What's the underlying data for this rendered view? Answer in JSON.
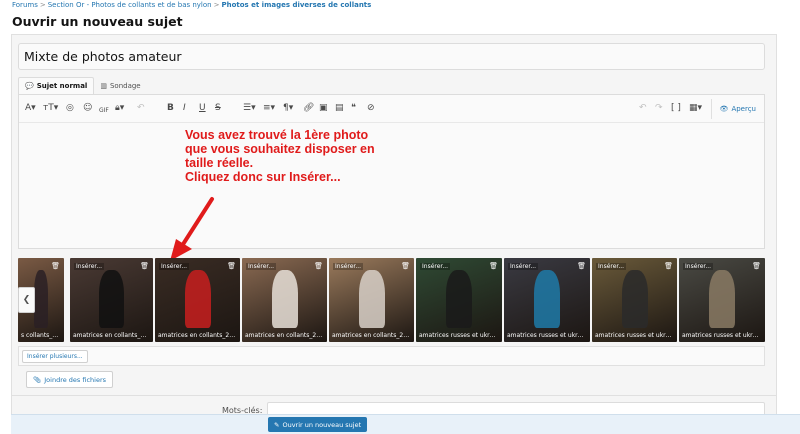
{
  "breadcrumb": {
    "items": [
      "Forums",
      "Section Or - Photos de collants et de bas nylon",
      "Photos et images diverses de collants"
    ],
    "separator": ">"
  },
  "page": {
    "title": "Ouvrir un nouveau sujet"
  },
  "form": {
    "title_value": "Mixte de photos amateur",
    "tabs": [
      {
        "label": "Sujet normal",
        "icon": "comments-icon",
        "active": true
      },
      {
        "label": "Sondage",
        "icon": "bar-chart-icon",
        "active": false
      }
    ],
    "preview_label": "Aperçu",
    "annotation_lines": [
      "Vous avez trouvé la 1ère photo",
      "que vous souhaitez disposer en",
      "taille réelle.",
      "Cliquez donc sur Insérer..."
    ],
    "annotation_color": "#e01b1b",
    "attachments": [
      {
        "insert_label": "",
        "caption": "s collants_204...",
        "bg": "#7a5a44",
        "accent": "#2a2024"
      },
      {
        "insert_label": "Insérer...",
        "caption": "amatrices en collants_205...",
        "bg": "#4a3a34",
        "accent": "#111111"
      },
      {
        "insert_label": "Insérer...",
        "caption": "amatrices en collants_206...",
        "bg": "#3a2c24",
        "accent": "#c81e1e"
      },
      {
        "insert_label": "Insérer...",
        "caption": "amatrices en collants_207...",
        "bg": "#8a6a52",
        "accent": "#e8e0d8"
      },
      {
        "insert_label": "Insérer...",
        "caption": "amatrices en collants_208...",
        "bg": "#9a7a5c",
        "accent": "#d8d0c8"
      },
      {
        "insert_label": "Insérer...",
        "caption": "amatrices russes et ukrain...",
        "bg": "#2f4a34",
        "accent": "#1a1a1a"
      },
      {
        "insert_label": "Insérer...",
        "caption": "amatrices russes et ukrain...",
        "bg": "#3a3a42",
        "accent": "#1e7aa8"
      },
      {
        "insert_label": "Insérer...",
        "caption": "amatrices russes et ukrain...",
        "bg": "#6a5a3a",
        "accent": "#2a2a2a"
      },
      {
        "insert_label": "Insérer...",
        "caption": "amatrices russes et ukrain...",
        "bg": "#4a4a44",
        "accent": "#8a7a64"
      }
    ],
    "insert_multiple_label": "Insérer plusieurs...",
    "attach_files_label": "Joindre des fichiers",
    "tags_label": "Mots-clés:",
    "submit_label": "Ouvrir un nouveau sujet"
  },
  "colors": {
    "link": "#2577b1",
    "primary_button": "#2577b1"
  }
}
